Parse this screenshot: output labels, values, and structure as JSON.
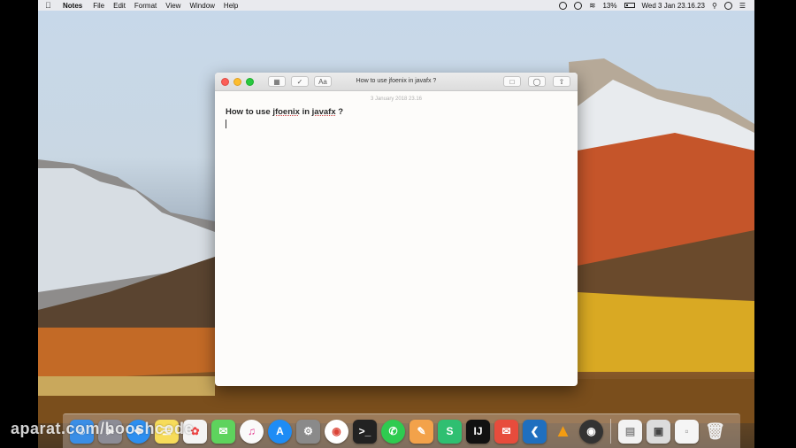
{
  "menubar": {
    "app": "Notes",
    "menus": [
      "File",
      "Edit",
      "Format",
      "View",
      "Window",
      "Help"
    ],
    "battery": "13%",
    "clock": "Wed 3 Jan  23.16.23"
  },
  "window": {
    "title": "How to use jfoenix in javafx ?",
    "format_label": "Aa",
    "date": "3 January 2018 23.16",
    "heading_pre": "How to use ",
    "heading_word1": "jfoenix",
    "heading_mid": " in ",
    "heading_word2": "javafx",
    "heading_post": " ?"
  },
  "dock": {
    "apps": [
      "Finder",
      "Launchpad",
      "Safari",
      "Notes",
      "Photos",
      "Messages",
      "iTunes",
      "App Store",
      "System Preferences",
      "Chrome",
      "Terminal",
      "WhatsApp",
      "Pencil",
      "Sourcetree",
      "IntelliJ IDEA",
      "Mail",
      "Visual Studio Code",
      "VLC",
      "OBS",
      "Document",
      "Screenshot",
      "Preview",
      "Trash"
    ]
  },
  "watermark": "aparat.com/hooshcode",
  "colors": {
    "accent": "#fc5f57"
  }
}
